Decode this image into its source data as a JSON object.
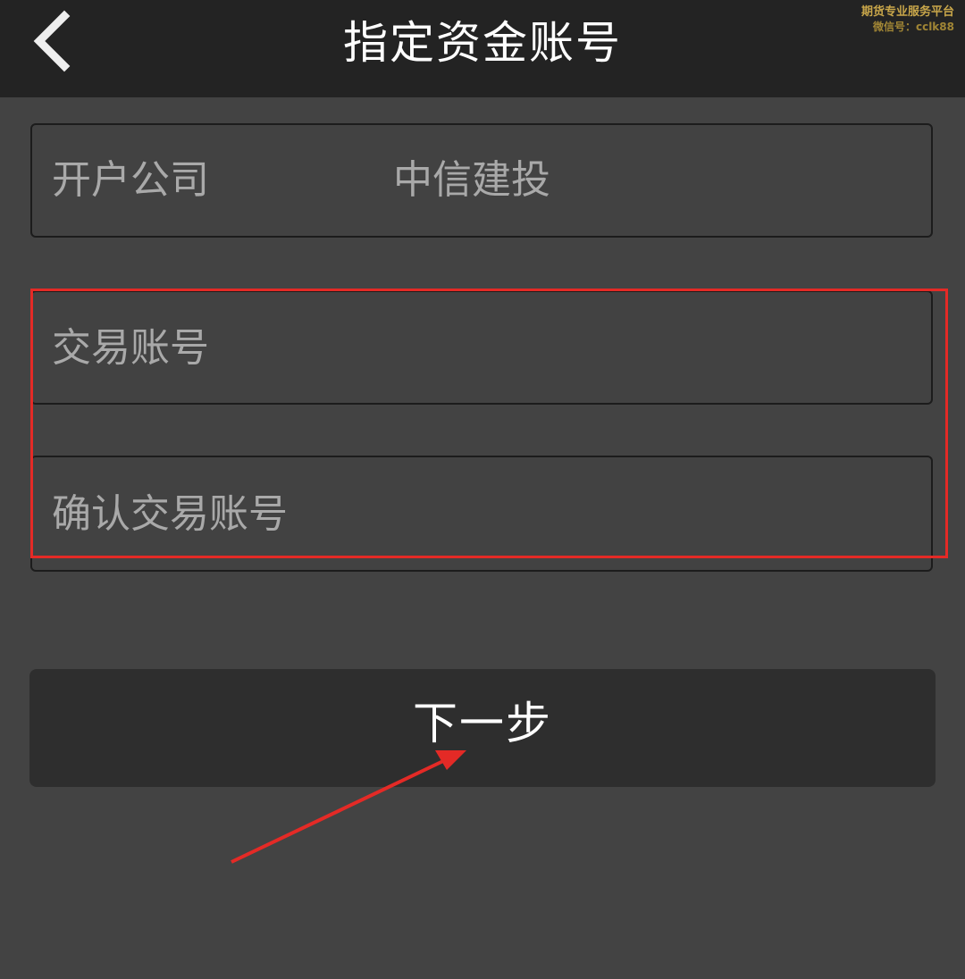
{
  "header": {
    "title": "指定资金账号",
    "back_icon": "chevron-left-icon"
  },
  "watermark": {
    "line1": "期货专业服务平台",
    "line2": "微信号：cclk88"
  },
  "form": {
    "company": {
      "label": "开户公司",
      "value": "中信建投"
    },
    "account": {
      "placeholder": "交易账号",
      "value": ""
    },
    "confirm_account": {
      "placeholder": "确认交易账号",
      "value": ""
    }
  },
  "next_button": {
    "label": "下一步"
  },
  "colors": {
    "background": "#434343",
    "header_bg": "#232323",
    "button_bg": "#2e2e2e",
    "annotation_red": "#e42a26",
    "watermark_gold": "#c8a64a"
  }
}
